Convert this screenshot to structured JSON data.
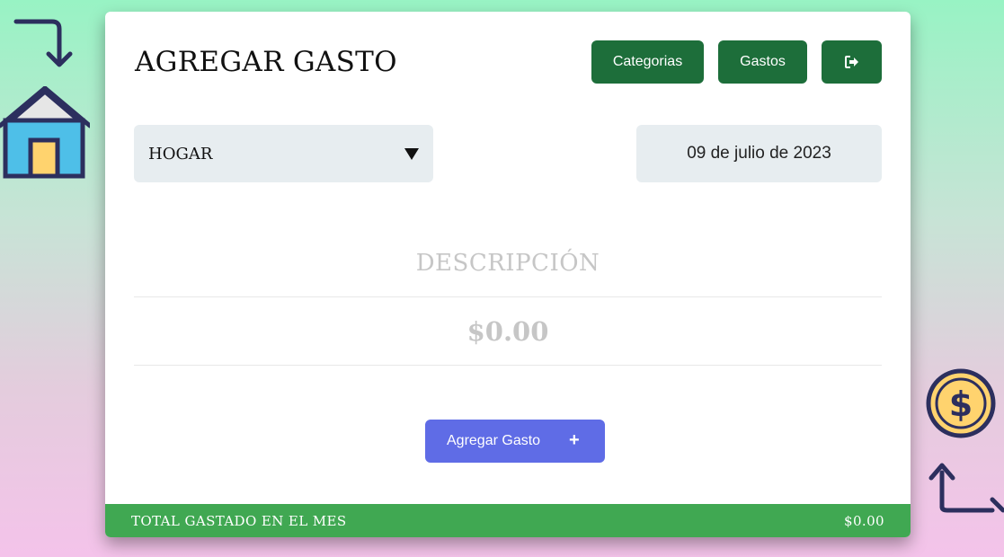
{
  "header": {
    "title": "AGREGAR GASTO",
    "buttons": {
      "categories_label": "Categorias",
      "expenses_label": "Gastos",
      "logout_icon": "sign-out-icon"
    }
  },
  "form": {
    "category_selected": "HOGAR",
    "date_value": "09 de julio de 2023",
    "description_placeholder": "DESCRIPCIÓN",
    "amount_placeholder": "$0.00",
    "submit_label": "Agregar Gasto",
    "submit_icon": "plus-icon"
  },
  "footer": {
    "label": "TOTAL GASTADO EN EL MES",
    "total": "$0.00"
  },
  "decorations": {
    "icons": [
      "arrow-down-turn-icon",
      "house-icon",
      "dollar-coin-icon",
      "arrow-up-turn-icon"
    ]
  },
  "colors": {
    "primary_button": "#1d6e3a",
    "submit_button": "#5f6ce6",
    "footer_bar": "#40a852",
    "input_background": "#e7edf0",
    "house_wall": "#4ebfe8",
    "house_door": "#ffd36e",
    "coin": "#ffd36e",
    "icon_outline": "#2c2f5e"
  }
}
